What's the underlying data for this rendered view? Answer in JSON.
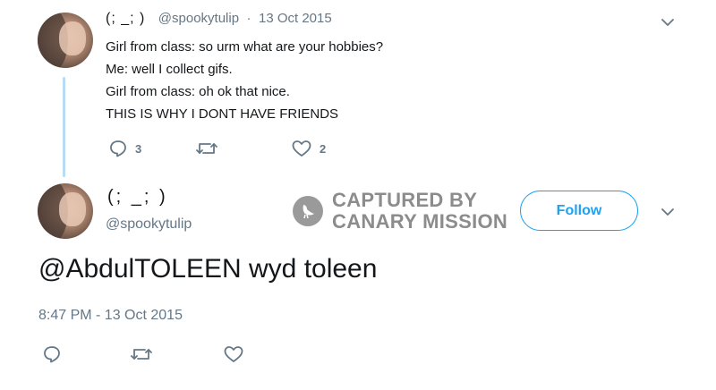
{
  "first_tweet": {
    "display_name": "(; _; )",
    "handle": "@spookytulip",
    "separator": "·",
    "date": "13 Oct 2015",
    "lines": [
      "Girl from class: so urm what are your hobbies?",
      "Me: well I collect gifs.",
      "Girl from class: oh ok that nice.",
      "THIS IS WHY I DONT HAVE FRIENDS"
    ],
    "actions": {
      "reply_count": "3",
      "retweet_count": "",
      "like_count": "2"
    }
  },
  "main_tweet": {
    "display_name": "(; _; )",
    "handle": "@spookytulip",
    "follow_label": "Follow",
    "text": "@AbdulTOLEEN wyd toleen",
    "timestamp": "8:47 PM - 13 Oct 2015"
  },
  "watermark": {
    "line1": "CAPTURED BY",
    "line2": "CANARY MISSION"
  },
  "icons": {
    "reply": "reply-icon",
    "retweet": "retweet-icon",
    "like": "heart-icon",
    "caret": "chevron-down-icon",
    "watermark": "canary-logo-icon"
  },
  "colors": {
    "accent": "#1da1f2",
    "muted": "#657786",
    "thread_line": "#b9dcf5",
    "watermark": "#8c8c8c"
  }
}
